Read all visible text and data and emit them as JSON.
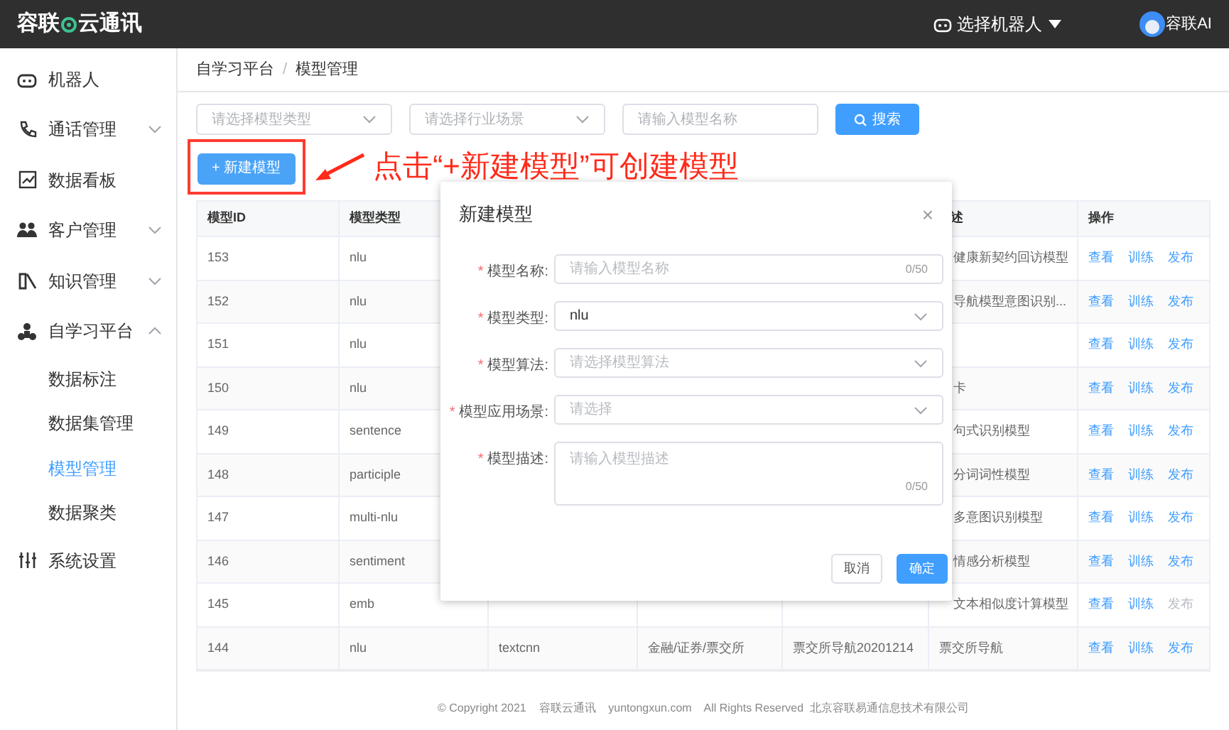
{
  "header": {
    "logo": "容联",
    "logo_rest": "云通讯",
    "robot_select": "选择机器人",
    "user": "容联AI"
  },
  "sidebar": {
    "items": [
      {
        "kind": "link",
        "label": "机器人"
      },
      {
        "kind": "group",
        "label": "通话管理",
        "expanded": false
      },
      {
        "kind": "link",
        "label": "数据看板"
      },
      {
        "kind": "group",
        "label": "客户管理",
        "expanded": false
      },
      {
        "kind": "group",
        "label": "知识管理",
        "expanded": false
      },
      {
        "kind": "group",
        "label": "自学习平台",
        "expanded": true,
        "children": [
          {
            "label": "数据标注",
            "selected": false
          },
          {
            "label": "数据集管理",
            "selected": false
          },
          {
            "label": "模型管理",
            "selected": true
          },
          {
            "label": "数据聚类",
            "selected": false
          }
        ]
      },
      {
        "kind": "link",
        "label": "系统设置"
      }
    ]
  },
  "breadcrumb": {
    "items": [
      "自学习平台",
      "模型管理"
    ],
    "separator": "/"
  },
  "filters": [
    {
      "kind": "select",
      "placeholder": "请选择模型类型"
    },
    {
      "kind": "select",
      "placeholder": "请选择行业场景"
    },
    {
      "kind": "input",
      "placeholder": "请输入模型名称"
    }
  ],
  "search_button": "搜索",
  "new_button": "+ 新建模型",
  "annotation": "点击“+新建模型”可创建模型",
  "table": {
    "columns": [
      "模型ID",
      "模型类型",
      "",
      "",
      "",
      "述",
      "操作"
    ],
    "rows": [
      {
        "cells": [
          "153",
          "nlu",
          "",
          "",
          "",
          "健康新契约回访模型"
        ],
        "actions": [
          {
            "label": "查看",
            "disabled": false
          },
          {
            "label": "训练",
            "disabled": false
          },
          {
            "label": "发布",
            "disabled": false
          }
        ]
      },
      {
        "cells": [
          "152",
          "nlu",
          "",
          "",
          "",
          "导航模型意图识别..."
        ],
        "actions": [
          {
            "label": "查看",
            "disabled": false
          },
          {
            "label": "训练",
            "disabled": false
          },
          {
            "label": "发布",
            "disabled": false
          }
        ]
      },
      {
        "cells": [
          "151",
          "nlu",
          "",
          "",
          "",
          ""
        ],
        "actions": [
          {
            "label": "查看",
            "disabled": false
          },
          {
            "label": "训练",
            "disabled": false
          },
          {
            "label": "发布",
            "disabled": false
          }
        ]
      },
      {
        "cells": [
          "150",
          "nlu",
          "",
          "",
          "",
          "卡"
        ],
        "actions": [
          {
            "label": "查看",
            "disabled": false
          },
          {
            "label": "训练",
            "disabled": false
          },
          {
            "label": "发布",
            "disabled": false
          }
        ]
      },
      {
        "cells": [
          "149",
          "sentence",
          "",
          "",
          "",
          "句式识别模型"
        ],
        "actions": [
          {
            "label": "查看",
            "disabled": false
          },
          {
            "label": "训练",
            "disabled": false
          },
          {
            "label": "发布",
            "disabled": false
          }
        ]
      },
      {
        "cells": [
          "148",
          "participle",
          "",
          "",
          "",
          "分词词性模型"
        ],
        "actions": [
          {
            "label": "查看",
            "disabled": false
          },
          {
            "label": "训练",
            "disabled": false
          },
          {
            "label": "发布",
            "disabled": false
          }
        ]
      },
      {
        "cells": [
          "147",
          "multi-nlu",
          "",
          "",
          "",
          "多意图识别模型"
        ],
        "actions": [
          {
            "label": "查看",
            "disabled": false
          },
          {
            "label": "训练",
            "disabled": false
          },
          {
            "label": "发布",
            "disabled": false
          }
        ]
      },
      {
        "cells": [
          "146",
          "sentiment",
          "",
          "",
          "",
          "情感分析模型"
        ],
        "actions": [
          {
            "label": "查看",
            "disabled": false
          },
          {
            "label": "训练",
            "disabled": false
          },
          {
            "label": "发布",
            "disabled": false
          }
        ]
      },
      {
        "cells": [
          "145",
          "emb",
          "",
          "",
          "",
          "文本相似度计算模型"
        ],
        "actions": [
          {
            "label": "查看",
            "disabled": false
          },
          {
            "label": "训练",
            "disabled": false
          },
          {
            "label": "发布",
            "disabled": true
          }
        ]
      },
      {
        "cells": [
          "144",
          "nlu",
          "textcnn",
          "金融/证券/票交所",
          "票交所导航20201214",
          "票交所导航"
        ],
        "actions": [
          {
            "label": "查看",
            "disabled": false
          },
          {
            "label": "训练",
            "disabled": false
          },
          {
            "label": "发布",
            "disabled": false
          }
        ]
      }
    ]
  },
  "footer": "© Copyright 2021    容联云通讯    yuntongxun.com    All Rights Reserved  北京容联易通信息技术有限公司",
  "dialog": {
    "title": "新建模型",
    "close": "×",
    "fields": [
      {
        "kind": "input",
        "required_mark": "*",
        "label": "模型名称:",
        "placeholder": "请输入模型名称",
        "counter": "0/50"
      },
      {
        "kind": "select",
        "required_mark": "*",
        "label": "模型类型:",
        "value": "nlu"
      },
      {
        "kind": "select",
        "required_mark": "*",
        "label": "模型算法:",
        "placeholder": "请选择模型算法"
      },
      {
        "kind": "select",
        "required_mark": "*",
        "label": "模型应用场景:",
        "placeholder": "请选择"
      },
      {
        "kind": "textarea",
        "required_mark": "*",
        "label": "模型描述:",
        "placeholder": "请输入模型描述",
        "counter": "0/50"
      }
    ],
    "buttons": [
      {
        "label": "取消",
        "primary": false
      },
      {
        "label": "确定",
        "primary": true
      }
    ]
  }
}
